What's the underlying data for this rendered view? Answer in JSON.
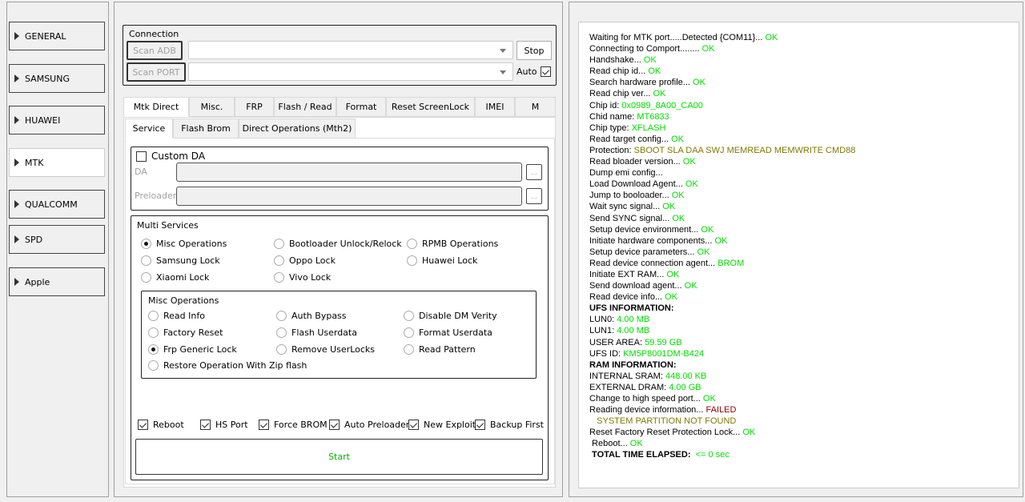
{
  "sidebar": {
    "items": [
      {
        "label": "GENERAL",
        "active": false
      },
      {
        "label": "SAMSUNG",
        "active": false
      },
      {
        "label": "HUAWEI",
        "active": false
      },
      {
        "label": "MTK",
        "active": true
      },
      {
        "label": "QUALCOMM",
        "active": false
      },
      {
        "label": "SPD",
        "active": false
      },
      {
        "label": "Apple",
        "active": false
      }
    ]
  },
  "connection": {
    "title": "Connection",
    "scan_adb": "Scan ADB",
    "scan_port": "Scan PORT",
    "adb_value": "",
    "port_value": "",
    "stop": "Stop",
    "auto": "Auto",
    "auto_checked": true
  },
  "tabs": [
    "Mtk Direct",
    "Misc.",
    "FRP",
    "Flash / Read",
    "Format",
    "Reset ScreenLock",
    "IMEI",
    "M"
  ],
  "subtabs": [
    "Service",
    "Flash Brom",
    "Direct Operations (Mth2)"
  ],
  "custom_da": {
    "label": "Custom DA",
    "checked": false,
    "da_label": "DA",
    "preloader_label": "Preloader",
    "browse": "..."
  },
  "multi_services": {
    "title": "Multi Services",
    "options": [
      "Misc Operations",
      "Bootloader Unlock/Relock",
      "RPMB Operations",
      "Samsung Lock",
      "Oppo Lock",
      "Huawei Lock",
      "Xiaomi Lock",
      "Vivo Lock"
    ],
    "selected": "Misc Operations"
  },
  "misc_operations": {
    "title": "Misc Operations",
    "options": [
      "Read Info",
      "Auth Bypass",
      "Disable DM Verity",
      "Factory Reset",
      "Flash Userdata",
      "Format Userdata",
      "Frp Generic Lock",
      "Remove UserLocks",
      "Read Pattern",
      "Restore Operation With Zip flash"
    ],
    "selected": "Frp Generic Lock"
  },
  "checks": [
    {
      "label": "Reboot",
      "checked": true
    },
    {
      "label": "HS Port",
      "checked": true
    },
    {
      "label": "Force BROM",
      "checked": true
    },
    {
      "label": "Auto Preloader",
      "checked": true
    },
    {
      "label": "New Exploit",
      "checked": true
    },
    {
      "label": "Backup First",
      "checked": true
    }
  ],
  "start": "Start",
  "colors": {
    "ok": "#00dd00",
    "warn": "#807800",
    "fail": "#8b0000",
    "start": "#00b000"
  },
  "log": [
    {
      "text": "Waiting for MTK port.....Detected {COM11}... ",
      "value": "OK",
      "color": "ok"
    },
    {
      "text": "Connecting to Comport........ ",
      "value": "OK",
      "color": "ok"
    },
    {
      "text": "Handshake... ",
      "value": "OK",
      "color": "ok"
    },
    {
      "text": "Read chip id... ",
      "value": "OK",
      "color": "ok"
    },
    {
      "text": "Search hardware profile... ",
      "value": "OK",
      "color": "ok"
    },
    {
      "text": "Read chip ver... ",
      "value": "OK",
      "color": "ok"
    },
    {
      "text": "Chip id: ",
      "value": "0x0989_8A00_CA00",
      "color": "ok"
    },
    {
      "text": "Chid name: ",
      "value": "MT6833",
      "color": "ok"
    },
    {
      "text": "Chip type: ",
      "value": "XFLASH",
      "color": "ok"
    },
    {
      "text": "Read target config... ",
      "value": "OK",
      "color": "ok"
    },
    {
      "text": "Protection: ",
      "value": "SBOOT SLA DAA SWJ MEMREAD MEMWRITE CMD88",
      "color": "warn"
    },
    {
      "text": "Read bloader version... ",
      "value": "OK",
      "color": "ok"
    },
    {
      "text": "Dump emi config...",
      "value": "",
      "color": "ok"
    },
    {
      "text": "Load Download Agent... ",
      "value": "OK",
      "color": "ok"
    },
    {
      "text": "Jump to booloader... ",
      "value": "OK",
      "color": "ok"
    },
    {
      "text": "Wait sync signal... ",
      "value": "OK",
      "color": "ok"
    },
    {
      "text": "Send SYNC signal... ",
      "value": "OK",
      "color": "ok"
    },
    {
      "text": "Setup device environment... ",
      "value": "OK",
      "color": "ok"
    },
    {
      "text": "Initiate hardware components... ",
      "value": "OK",
      "color": "ok"
    },
    {
      "text": "Setup device parameters... ",
      "value": "OK",
      "color": "ok"
    },
    {
      "text": "Read device connection agent... ",
      "value": "BROM",
      "color": "ok"
    },
    {
      "text": "Initiate EXT RAM... ",
      "value": "OK",
      "color": "ok"
    },
    {
      "text": "Send download agent... ",
      "value": "OK",
      "color": "ok"
    },
    {
      "text": "Read device info... ",
      "value": "OK",
      "color": "ok"
    },
    {
      "text": "UFS INFORMATION:",
      "value": "",
      "color": "ok",
      "bold": true
    },
    {
      "text": "LUN0: ",
      "value": "4.00 MB",
      "color": "ok"
    },
    {
      "text": "LUN1: ",
      "value": "4.00 MB",
      "color": "ok"
    },
    {
      "text": "USER AREA: ",
      "value": "59.59 GB",
      "color": "ok"
    },
    {
      "text": "UFS ID: ",
      "value": "KM5P8001DM-B424",
      "color": "ok"
    },
    {
      "text": "RAM INFORMATION:",
      "value": "",
      "color": "ok",
      "bold": true
    },
    {
      "text": "INTERNAL SRAM: ",
      "value": "448.00 KB",
      "color": "ok"
    },
    {
      "text": "EXTERNAL DRAM: ",
      "value": "4.00 GB",
      "color": "ok"
    },
    {
      "text": "Change to high speed port... ",
      "value": "OK",
      "color": "ok"
    },
    {
      "text": "Reading device information... ",
      "value": "FAILED",
      "color": "fail"
    },
    {
      "text": "   ",
      "value": "SYSTEM PARTITION NOT FOUND",
      "color": "warn"
    },
    {
      "text": "Reset Factory Reset Protection Lock... ",
      "value": "OK",
      "color": "ok"
    },
    {
      "text": " Reboot... ",
      "value": "OK",
      "color": "ok"
    },
    {
      "text": " TOTAL TIME ELAPSED:  ",
      "value": "<= 0 sec",
      "color": "ok",
      "bold": true
    }
  ]
}
